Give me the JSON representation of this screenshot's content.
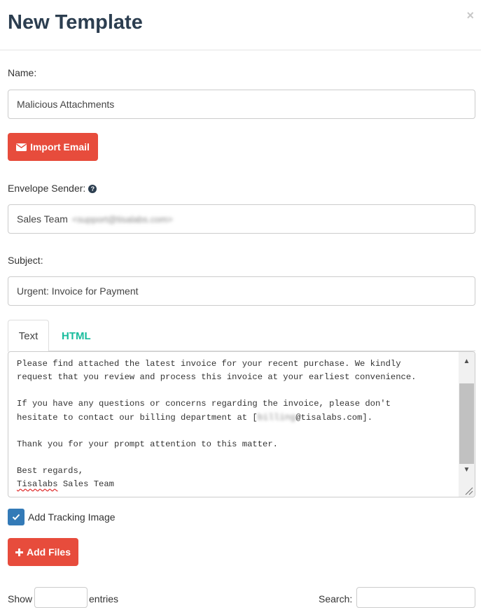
{
  "modal": {
    "title": "New Template",
    "close": "×"
  },
  "form": {
    "name_label": "Name:",
    "name_value": "Malicious Attachments",
    "import_button": "Import Email",
    "sender_label": "Envelope Sender:",
    "sender_name": "Sales Team",
    "sender_email_blurred": "<support@tisalabs.com>",
    "subject_label": "Subject:",
    "subject_value": "Urgent: Invoice for Payment"
  },
  "tabs": [
    {
      "label": "Text",
      "active": true
    },
    {
      "label": "HTML",
      "active": false
    }
  ],
  "body_text": {
    "line1": "Please find attached the latest invoice for your recent purchase. We kindly",
    "line2": "request that you review and process this invoice at your earliest convenience.",
    "line3": "",
    "line4": "If you have any questions or concerns regarding the invoice, please don't",
    "line5_pre": "hesitate to contact our billing department at [",
    "line5_blur": "billing",
    "line5_post": "@tisalabs.com].",
    "line6": "",
    "line7": "Thank you for your prompt attention to this matter.",
    "line8": "",
    "line9": "Best regards,",
    "line10_word": "Tisalabs",
    "line10_rest": " Sales Team"
  },
  "tracking": {
    "checked": true,
    "label": "Add Tracking Image"
  },
  "add_files_button": "Add Files",
  "table_controls": {
    "show_label": "Show",
    "entries_label": "entries",
    "search_label": "Search:"
  },
  "colors": {
    "danger": "#e74c3c",
    "title": "#2c3e50",
    "tab_link": "#18bc9c",
    "checkbox": "#337ab7"
  }
}
